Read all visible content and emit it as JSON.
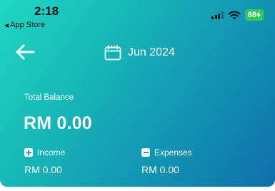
{
  "status_bar": {
    "time": "2:18",
    "back_to_app": "App Store",
    "battery": "88"
  },
  "header": {
    "month": "Jun 2024"
  },
  "balance": {
    "label": "Total Balance",
    "amount": "RM 0.00"
  },
  "income": {
    "label": "Income",
    "amount": "RM 0.00"
  },
  "expenses": {
    "label": "Expenses",
    "amount": "RM 0.00"
  },
  "colors": {
    "gradient_start": "#1ed9c2",
    "gradient_end": "#0f6fac",
    "battery": "#34c759"
  }
}
